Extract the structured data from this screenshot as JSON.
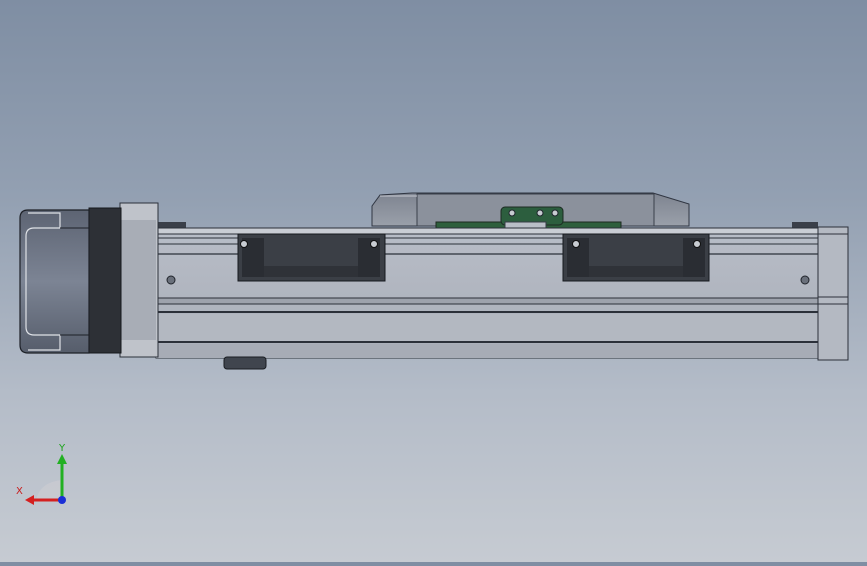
{
  "viewport": {
    "name": "linear-actuator-model",
    "view": "front"
  },
  "triad": {
    "x_label": "X",
    "y_label": "Y",
    "x_color": "#d42020",
    "y_color": "#22b022",
    "z_color": "#1a2fd6"
  }
}
